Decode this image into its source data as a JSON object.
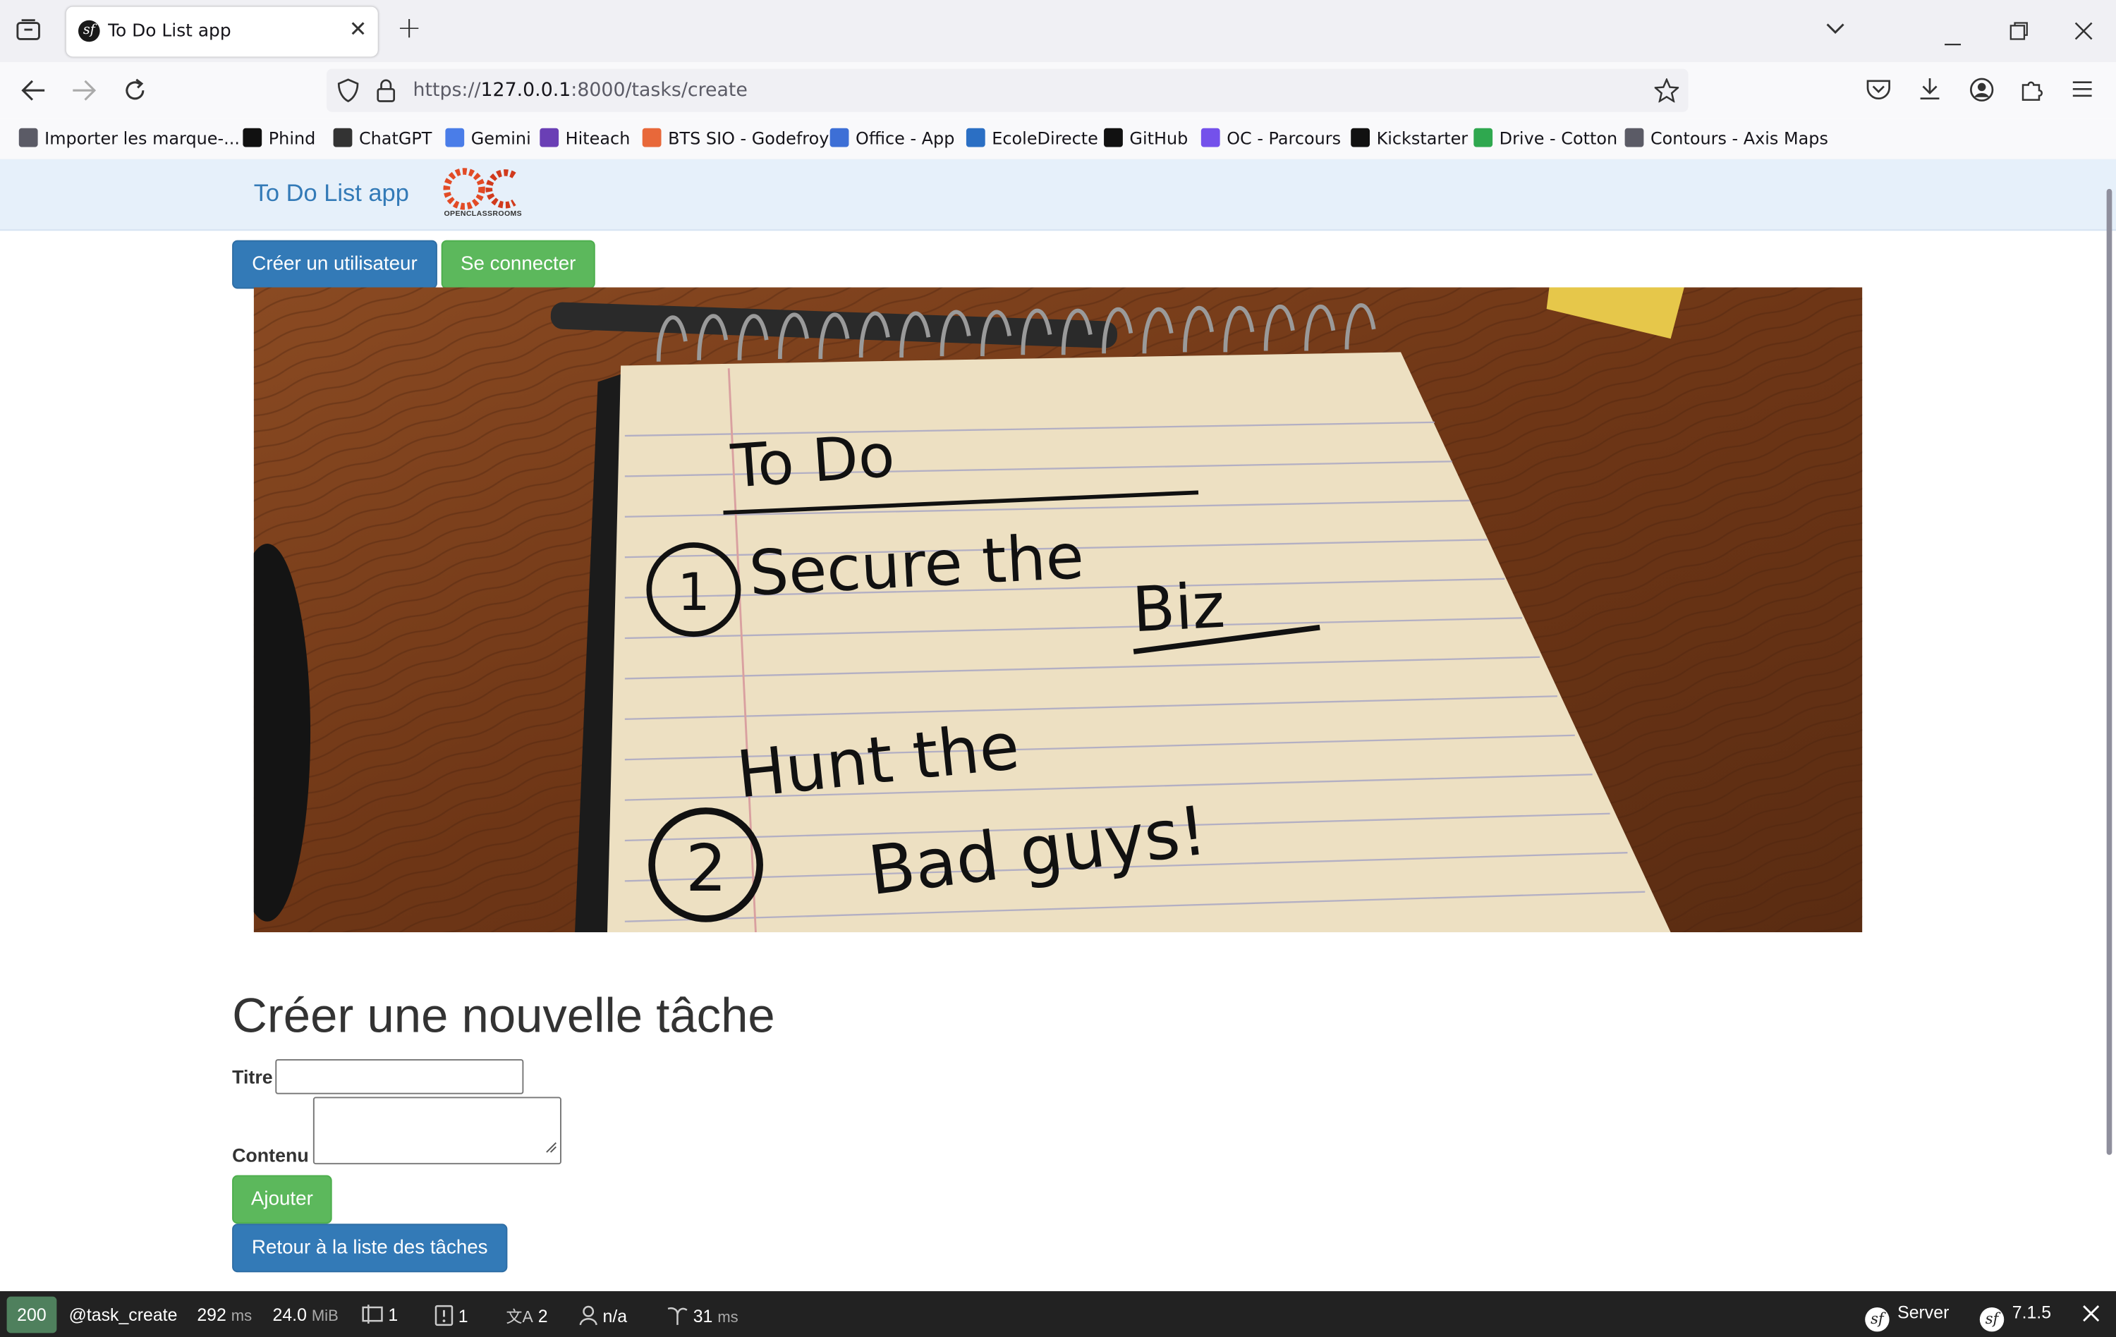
{
  "browser": {
    "tab_title": "To Do List app",
    "new_tab": "+",
    "url_prefix": "https://",
    "url_host": "127.0.0.1",
    "url_rest": ":8000/tasks/create",
    "bookmarks": [
      {
        "label": "Importer les marque-...",
        "icon": "import-icon",
        "color": "#5b5b66"
      },
      {
        "label": "Phind",
        "icon": "phind-icon",
        "color": "#111111"
      },
      {
        "label": "ChatGPT",
        "icon": "chatgpt-icon",
        "color": "#333333"
      },
      {
        "label": "Gemini",
        "icon": "gemini-icon",
        "color": "#4a7de8"
      },
      {
        "label": "Hiteach",
        "icon": "hiteach-icon",
        "color": "#6a3fb5"
      },
      {
        "label": "BTS SIO - Godefroy",
        "icon": "star-icon",
        "color": "#e8683a"
      },
      {
        "label": "Office - App",
        "icon": "office-icon",
        "color": "#3d6fd6"
      },
      {
        "label": "EcoleDirecte",
        "icon": "ecoledirecte-icon",
        "color": "#2b6fc4"
      },
      {
        "label": "GitHub",
        "icon": "github-icon",
        "color": "#111111"
      },
      {
        "label": "OC - Parcours",
        "icon": "oc-icon",
        "color": "#7451eb"
      },
      {
        "label": "Kickstarter",
        "icon": "kickstarter-icon",
        "color": "#111111"
      },
      {
        "label": "Drive - Cotton",
        "icon": "drive-icon",
        "color": "#2fa84f"
      },
      {
        "label": "Contours - Axis Maps",
        "icon": "globe-icon",
        "color": "#5b5b66"
      }
    ]
  },
  "app": {
    "brand": "To Do List app",
    "logo_text": "OC",
    "logo_subtext": "OPENCLASSROOMS",
    "create_user": "Créer un utilisateur",
    "login": "Se connecter",
    "hero_heading": "To Do",
    "hero_line1": "Secure the",
    "hero_line1b": "Biz",
    "hero_line2": "Hunt the",
    "hero_line2b": "Bad guys!",
    "hero_num1": "1",
    "hero_num2": "2",
    "page_title": "Créer une nouvelle tâche",
    "label_title": "Titre",
    "label_content": "Contenu",
    "submit": "Ajouter",
    "back": "Retour à la liste des tâches"
  },
  "profiler": {
    "status": "200",
    "route": "@task_create",
    "time_value": "292",
    "time_unit": "ms",
    "memory_value": "24.0",
    "memory_unit": "MiB",
    "forms": "1",
    "logs": "1",
    "translations": "2",
    "user": "n/a",
    "twig_value": "31",
    "twig_unit": "ms",
    "server": "Server",
    "version": "7.1.5"
  },
  "colors": {
    "primary": "#337ab7",
    "success": "#5cb85c",
    "appbar": "#e6f0fa",
    "profiler_bg": "#222222",
    "status_ok": "#4f805d"
  }
}
